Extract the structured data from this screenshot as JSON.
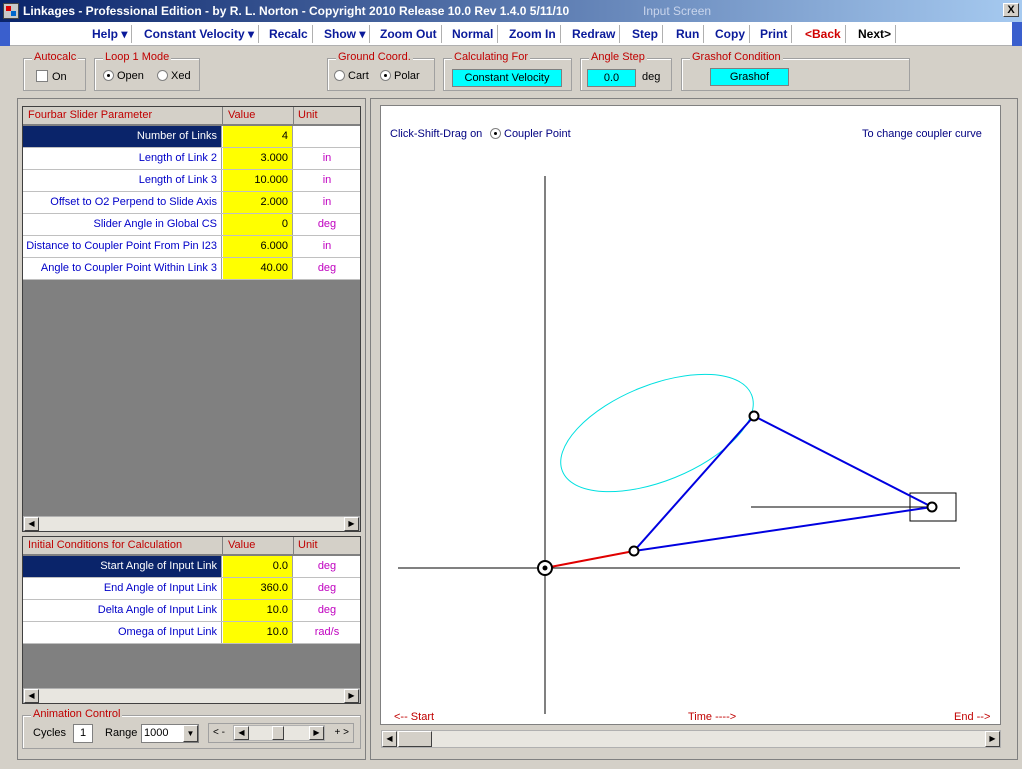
{
  "window": {
    "title": "Linkages - Professional Edition - by R. L. Norton - Copyright 2010   Release 10.0   Rev 1.4.0   5/11/10",
    "screen": "Input Screen",
    "close": "X"
  },
  "menu": [
    {
      "label": "Help ▾",
      "name": "menu-help"
    },
    {
      "label": "Constant Velocity ▾",
      "name": "menu-constant-velocity"
    },
    {
      "label": "Recalc",
      "name": "menu-recalc"
    },
    {
      "label": "Show ▾",
      "name": "menu-show"
    },
    {
      "label": "Zoom Out",
      "name": "menu-zoom-out"
    },
    {
      "label": "Normal",
      "name": "menu-normal"
    },
    {
      "label": "Zoom In",
      "name": "menu-zoom-in"
    },
    {
      "label": "Redraw",
      "name": "menu-redraw"
    },
    {
      "label": "Step",
      "name": "menu-step"
    },
    {
      "label": "Run",
      "name": "menu-run"
    },
    {
      "label": "Copy",
      "name": "menu-copy"
    },
    {
      "label": "Print",
      "name": "menu-print"
    },
    {
      "label": "<Back",
      "name": "menu-back"
    },
    {
      "label": "Next>",
      "name": "menu-next"
    }
  ],
  "options": {
    "autocalc": {
      "title": "Autocalc",
      "label": "On",
      "checked": false
    },
    "loop_mode": {
      "title": "Loop 1 Mode",
      "open": "Open",
      "crossed": "Xed",
      "selected": "Open"
    },
    "ground_coord": {
      "title": "Ground Coord.",
      "cart": "Cart",
      "polar": "Polar",
      "selected": "Polar"
    },
    "calculating_for": {
      "title": "Calculating For",
      "value": "Constant Velocity"
    },
    "angle_step": {
      "title": "Angle Step",
      "value": "0.0",
      "unit": "deg"
    },
    "grashof": {
      "title": "Grashof Condition",
      "value": "Grashof"
    }
  },
  "params_table": {
    "headers": [
      "Fourbar Slider Parameter",
      "Value",
      "Unit"
    ],
    "rows": [
      {
        "name": "Number of Links",
        "value": "4",
        "unit": ""
      },
      {
        "name": "Length of Link 2",
        "value": "3.000",
        "unit": "in"
      },
      {
        "name": "Length of Link 3",
        "value": "10.000",
        "unit": "in"
      },
      {
        "name": "Offset to O2 Perpend to Slide Axis",
        "value": "2.000",
        "unit": "in"
      },
      {
        "name": "Slider Angle in Global CS",
        "value": "0",
        "unit": "deg"
      },
      {
        "name": "Distance to Coupler Point From Pin I23",
        "value": "6.000",
        "unit": "in"
      },
      {
        "name": "Angle to Coupler Point Within Link 3",
        "value": "40.00",
        "unit": "deg"
      }
    ]
  },
  "init_table": {
    "headers": [
      "Initial Conditions for Calculation",
      "Value",
      "Unit"
    ],
    "rows": [
      {
        "name": "Start Angle of Input Link",
        "value": "0.0",
        "unit": "deg"
      },
      {
        "name": "End Angle of Input Link",
        "value": "360.0",
        "unit": "deg"
      },
      {
        "name": "Delta Angle of Input Link",
        "value": "10.0",
        "unit": "deg"
      },
      {
        "name": "Omega of Input Link",
        "value": "10.0",
        "unit": "rad/s"
      }
    ]
  },
  "animation": {
    "title": "Animation Control",
    "cycles_label": "Cycles",
    "cycles_value": "1",
    "range_label": "Range",
    "range_value": "1000",
    "speed_left": "< -",
    "speed_right": "+ >"
  },
  "canvas": {
    "drag_label": "Click-Shift-Drag on",
    "drag_option": "Coupler Point",
    "hint": "To change coupler curve",
    "start": "<-- Start",
    "time": "Time ---->",
    "end": "End -->"
  },
  "colors": {
    "link2": "#e00000",
    "links": "#0000e0",
    "coupler_curve": "#00e0e0"
  }
}
